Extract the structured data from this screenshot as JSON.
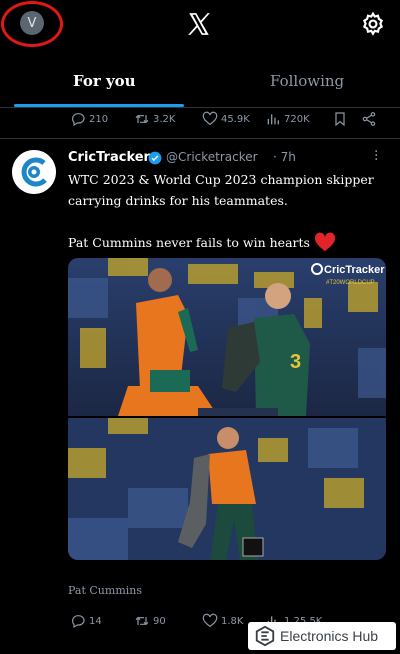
{
  "topbar": {
    "avatar_initial": "V"
  },
  "tabs": [
    {
      "label": "For you",
      "active": true
    },
    {
      "label": "Following",
      "active": false
    }
  ],
  "prev_tweet_actions": {
    "replies": "210",
    "reposts": "3.2K",
    "likes": "45.9K",
    "views": "720K"
  },
  "tweet": {
    "author": "CricTracker",
    "handle": "@Cricketracker",
    "time": "· 7h",
    "text_line1": "WTC 2023 & World Cup 2023 champion skipper",
    "text_line2": "carrying drinks for his teammates.",
    "text_line3": "Pat Cummins never fails to win hearts",
    "media_brand": "CricTracker",
    "media_tag": "#T20WORLDCUP",
    "media_caption": "Pat Cummins",
    "actions": {
      "replies": "14",
      "reposts": "90",
      "likes": "1.8K",
      "views": "1.25.5K"
    }
  },
  "watermark": {
    "text": "Electronics Hub"
  },
  "colors": {
    "accent": "#1d9bf0",
    "highlight_ring": "#e01818",
    "heart": "#e0242a"
  }
}
